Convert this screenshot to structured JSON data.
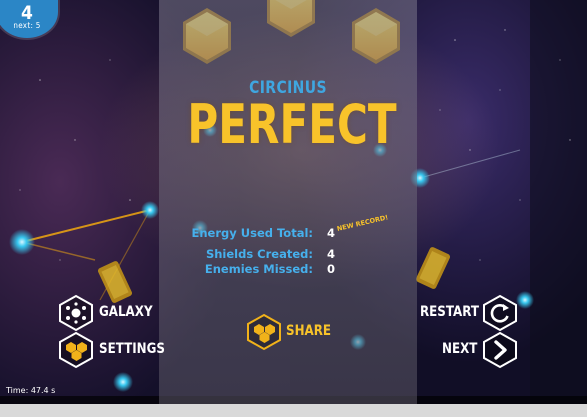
{
  "hud": {
    "level": "4",
    "next_label": "next: 5",
    "time_label": "Time: 47.4 s"
  },
  "result": {
    "constellation": "CIRCINUS",
    "title": "PERFECT",
    "stars_earned": 3,
    "stars_total": 3
  },
  "stats": [
    {
      "label": "Energy Used Total:",
      "value": "4"
    },
    {
      "label": "Shields Created:",
      "value": "4"
    },
    {
      "label": "Enemies Missed:",
      "value": "0"
    }
  ],
  "new_record_label": "NEW RECORD!",
  "buttons": {
    "galaxy": "GALAXY",
    "settings": "SETTINGS",
    "share": "SHARE",
    "restart": "RESTART",
    "next": "NEXT"
  },
  "icons": {
    "galaxy": "galaxy-icon",
    "settings": "honeycomb-icon",
    "share": "honeycomb-icon",
    "restart": "restart-icon",
    "next": "chevron-right-icon"
  },
  "colors": {
    "accent_yellow": "#f8c32a",
    "accent_blue": "#46b0ec",
    "level_badge": "#2b86c6"
  }
}
